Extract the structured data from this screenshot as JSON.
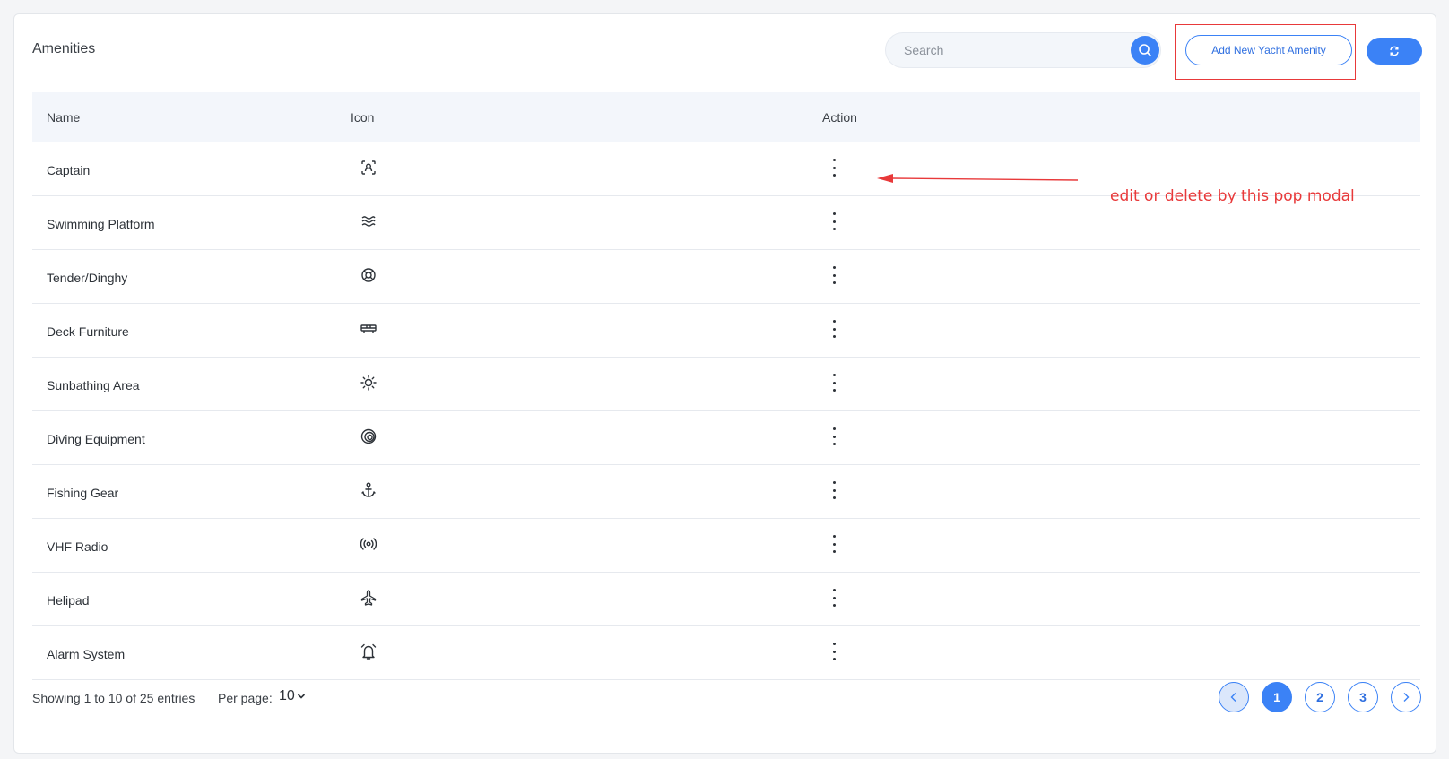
{
  "header": {
    "title": "Amenities",
    "search_placeholder": "Search",
    "add_button_label": "Add New Yacht Amenity"
  },
  "table": {
    "columns": [
      "Name",
      "Icon",
      "Action"
    ],
    "rows": [
      {
        "name": "Captain",
        "icon": "user-scan-icon"
      },
      {
        "name": "Swimming Platform",
        "icon": "waves-icon"
      },
      {
        "name": "Tender/Dinghy",
        "icon": "life-buoy-icon"
      },
      {
        "name": "Deck Furniture",
        "icon": "sofa-icon"
      },
      {
        "name": "Sunbathing Area",
        "icon": "sun-icon"
      },
      {
        "name": "Diving Equipment",
        "icon": "spiral-icon"
      },
      {
        "name": "Fishing Gear",
        "icon": "anchor-icon"
      },
      {
        "name": "VHF Radio",
        "icon": "radio-signal-icon"
      },
      {
        "name": "Helipad",
        "icon": "plane-icon"
      },
      {
        "name": "Alarm System",
        "icon": "alarm-clock-icon"
      }
    ]
  },
  "annotation": {
    "text": "edit or delete by this pop modal",
    "color": "#e8393a"
  },
  "footer": {
    "info": "Showing 1 to 10 of 25 entries",
    "per_page_label": "Per page:",
    "per_page_value": "10",
    "pages": [
      "1",
      "2",
      "3"
    ],
    "current_page": "1"
  },
  "colors": {
    "accent": "#3b82f6",
    "annotation": "#e8393a"
  }
}
